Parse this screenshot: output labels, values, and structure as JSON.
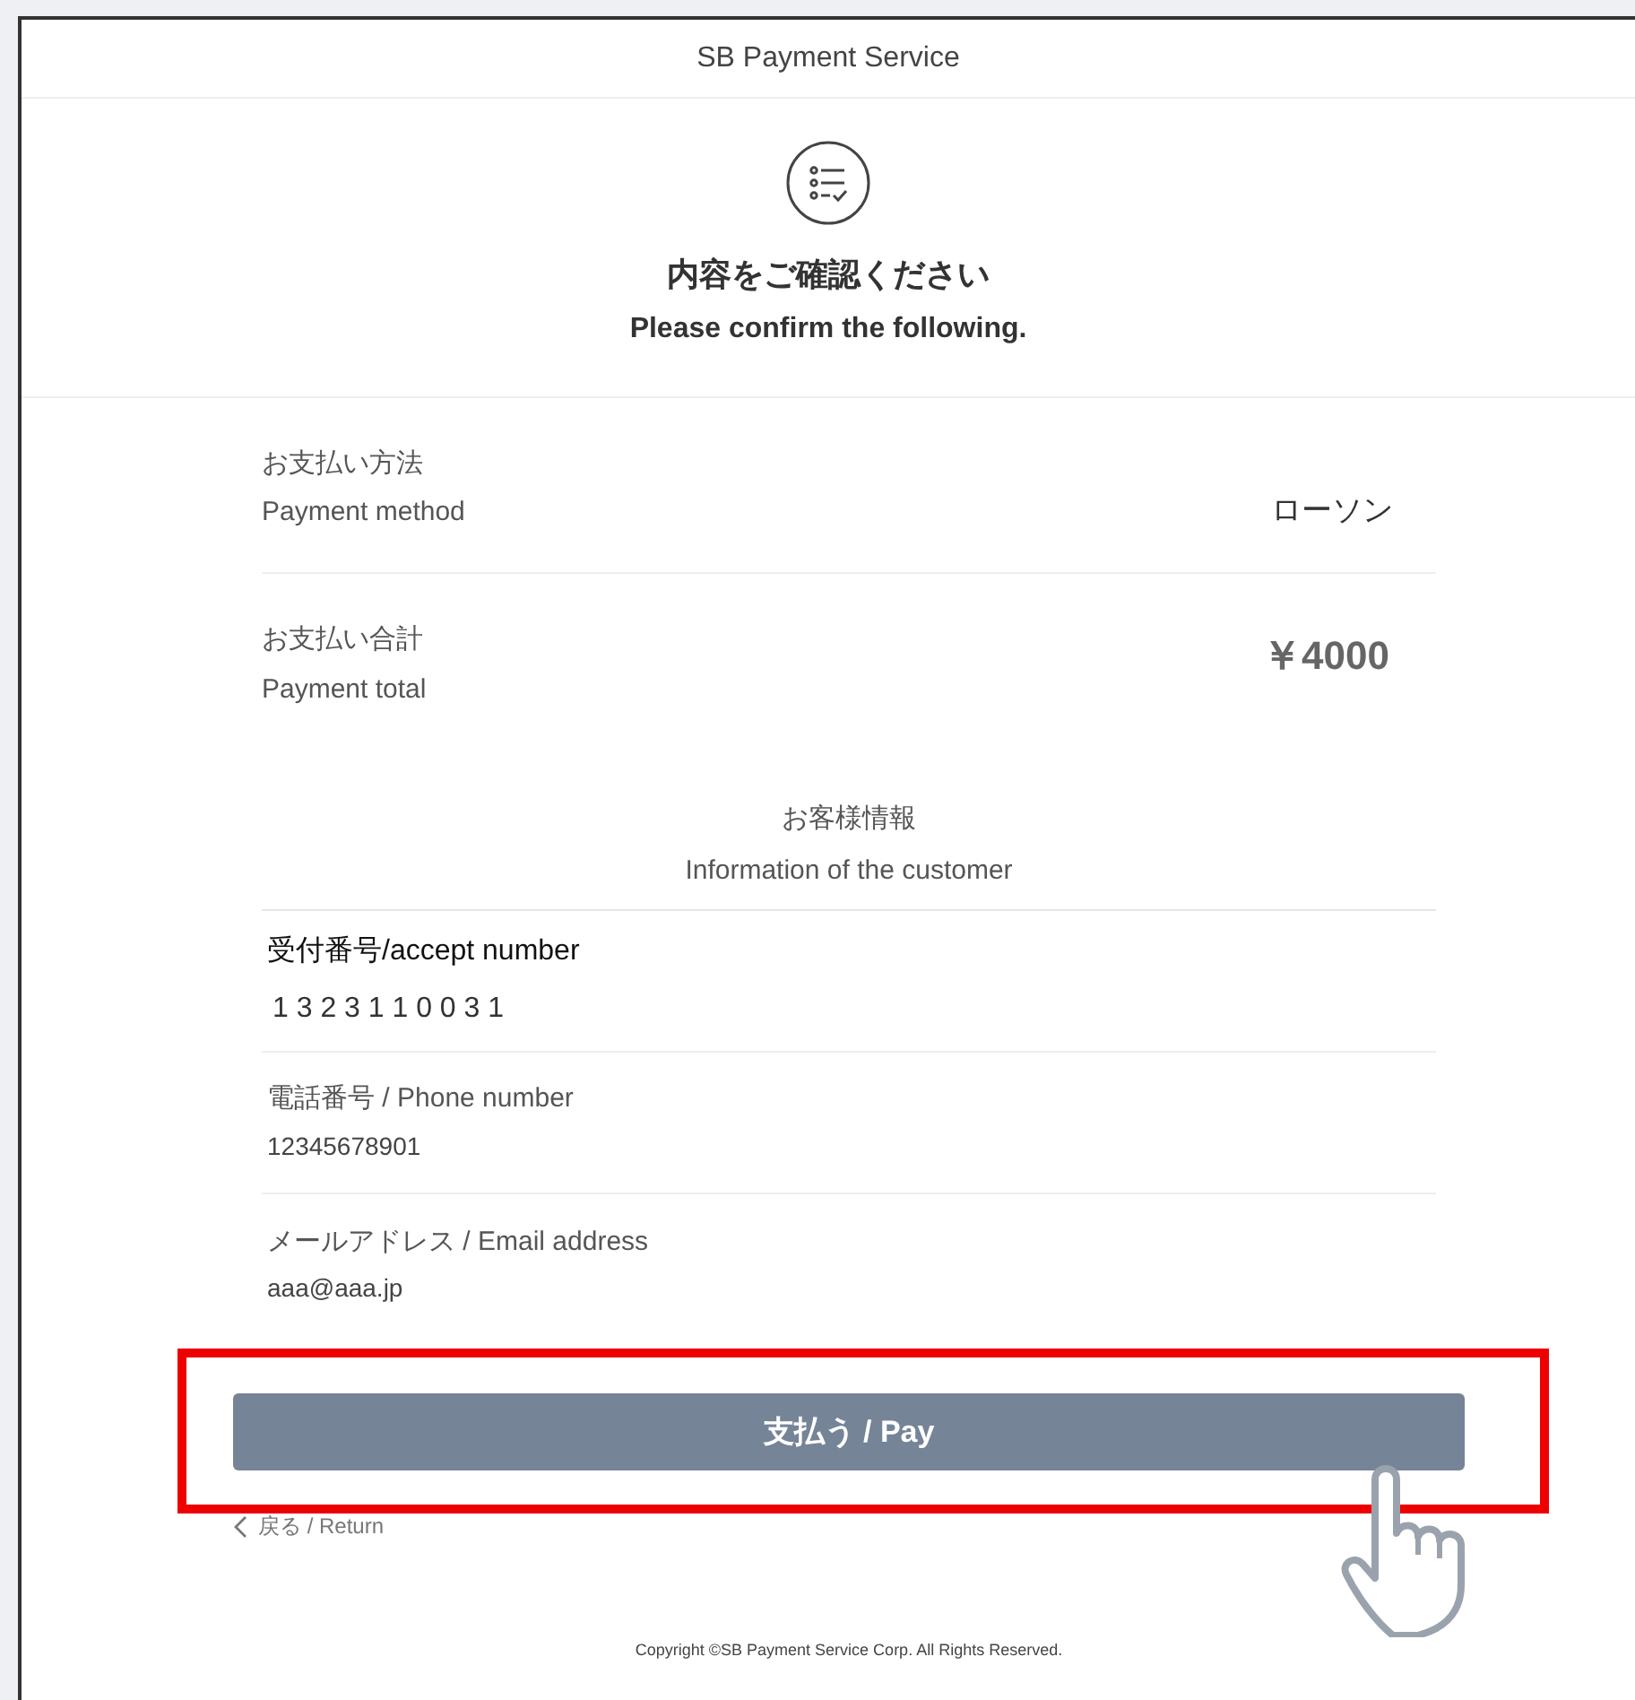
{
  "header": {
    "title": "SB Payment Service"
  },
  "heading": {
    "title_ja": "内容をご確認ください",
    "title_en": "Please confirm the following."
  },
  "summary": [
    {
      "kind": "method",
      "label_ja": "お支払い方法",
      "label_en": "Payment method",
      "value": "ローソン"
    },
    {
      "kind": "total",
      "label_ja": "お支払い合計",
      "label_en": "Payment total",
      "value": "￥4000"
    }
  ],
  "customer": {
    "title_ja": "お客様情報",
    "title_en": "Information of the customer",
    "fields": [
      {
        "kind": "accept",
        "label": "受付番号/accept number",
        "value": "1 3 2 3 1 1 0 0 3 1"
      },
      {
        "kind": "plain",
        "label": "電話番号 / Phone number",
        "value": "12345678901"
      },
      {
        "kind": "plain",
        "label": "メールアドレス / Email address",
        "value": "aaa@aaa.jp"
      }
    ]
  },
  "pay_button": "支払う / Pay",
  "return_link": "戻る / Return",
  "copyright": "Copyright ©SB Payment Service Corp. All Rights Reserved."
}
